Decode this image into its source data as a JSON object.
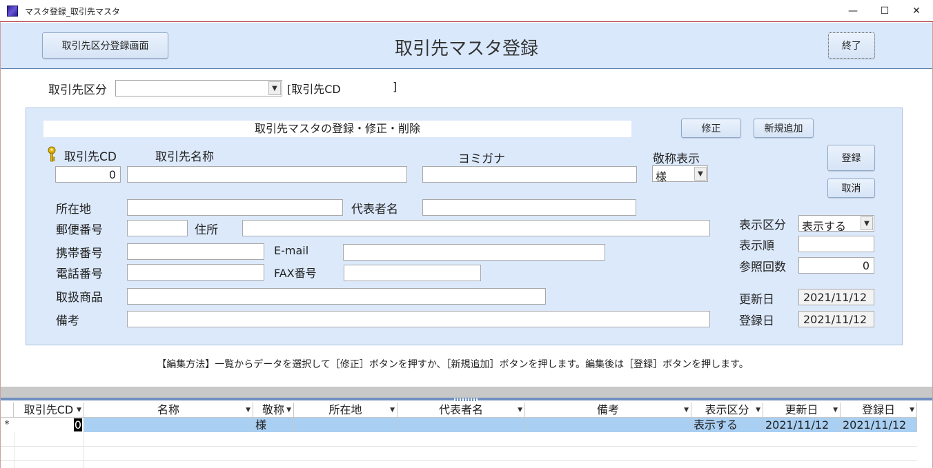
{
  "window": {
    "title": "マスタ登録_取引先マスタ",
    "minimize": "—",
    "maximize": "☐",
    "close": "✕"
  },
  "header": {
    "category_button": "取引先区分登録画面",
    "title": "取引先マスタ登録",
    "exit_button": "終了"
  },
  "filter": {
    "category_label": "取引先区分",
    "category_value": "",
    "code_bracket": "[取引先CD",
    "code_close": "]"
  },
  "panel": {
    "title": "取引先マスタの登録・修正・削除",
    "edit_button": "修正",
    "new_button": "新規追加",
    "register_button": "登録",
    "cancel_button": "取消",
    "fields": {
      "code_label": "取引先CD",
      "code_value": "0",
      "name_label": "取引先名称",
      "name_value": "",
      "kana_label": "ヨミガナ",
      "kana_value": "",
      "honorific_label": "敬称表示",
      "honorific_value": "様",
      "location_label": "所在地",
      "location_value": "",
      "rep_label": "代表者名",
      "rep_value": "",
      "postal_label": "郵便番号",
      "postal_value": "",
      "address_label": "住所",
      "address_value": "",
      "mobile_label": "携帯番号",
      "mobile_value": "",
      "email_label": "E-mail",
      "email_value": "",
      "phone_label": "電話番号",
      "phone_value": "",
      "fax_label": "FAX番号",
      "fax_value": "",
      "products_label": "取扱商品",
      "products_value": "",
      "memo_label": "備考",
      "memo_value": "",
      "display_label": "表示区分",
      "display_value": "表示する",
      "order_label": "表示順",
      "order_value": "",
      "ref_label": "参照回数",
      "ref_value": "0",
      "updated_label": "更新日",
      "updated_value": "2021/11/12",
      "created_label": "登録日",
      "created_value": "2021/11/12"
    }
  },
  "note": "【編集方法】一覧からデータを選択して［修正］ボタンを押すか、［新規追加］ボタンを押します。編集後は［登録］ボタンを押します。",
  "grid": {
    "columns": [
      "取引先CD",
      "名称",
      "敬称",
      "所在地",
      "代表者名",
      "備考",
      "表示区分",
      "更新日",
      "登録日"
    ],
    "new_row_marker": "*",
    "row": [
      "0",
      "",
      "様",
      "",
      "",
      "",
      "表示する",
      "2021/11/12",
      "2021/11/12"
    ]
  }
}
